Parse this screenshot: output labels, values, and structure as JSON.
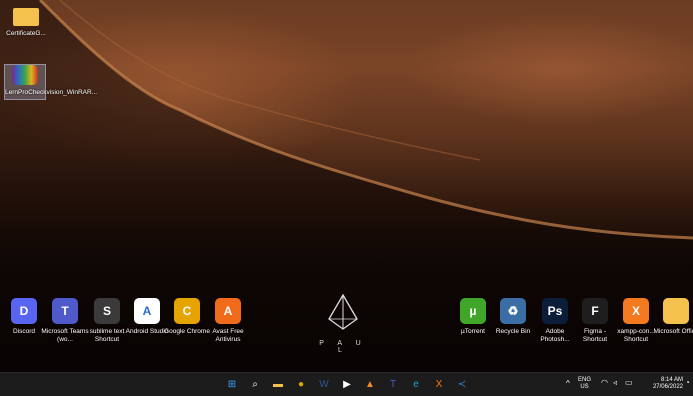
{
  "desktop_left": [
    {
      "label": "CertificateG...",
      "icon": "folder-icon"
    },
    {
      "label": "LernProCheckvision_WinRAR...",
      "icon": "winrar-icon"
    }
  ],
  "dock_left": [
    {
      "label": "Discord",
      "icon": "discord-icon",
      "color": "#5865F2",
      "glyph": "D"
    },
    {
      "label": "Microsoft Teams (wo...",
      "icon": "teams-icon",
      "color": "#5059C9",
      "glyph": "T"
    },
    {
      "label": "sublime text Shortcut",
      "icon": "sublime-icon",
      "color": "#3a3a3a",
      "glyph": "S"
    },
    {
      "label": "Android Studio",
      "icon": "android-studio-icon",
      "color": "#ffffff",
      "glyph": "A"
    },
    {
      "label": "Google Chrome",
      "icon": "chrome-icon",
      "color": "#e6a400",
      "glyph": "C"
    },
    {
      "label": "Avast Free Antivirus",
      "icon": "avast-icon",
      "color": "#f26b1d",
      "glyph": "A"
    }
  ],
  "dock_right": [
    {
      "label": "µTorrent",
      "icon": "utorrent-icon",
      "color": "#3fa62a",
      "glyph": "µ"
    },
    {
      "label": "Recycle Bin",
      "icon": "recycle-bin-icon",
      "color": "#3b6ea5",
      "glyph": "♻"
    },
    {
      "label": "Adobe Photosh...",
      "icon": "photoshop-icon",
      "color": "#0c1d3a",
      "glyph": "Ps"
    },
    {
      "label": "Figma - Shortcut",
      "icon": "figma-icon",
      "color": "#1e1e1e",
      "glyph": "F"
    },
    {
      "label": "xampp-con... Shortcut",
      "icon": "xampp-icon",
      "color": "#f47a20",
      "glyph": "X"
    },
    {
      "label": "Microsoft Office",
      "icon": "folder-icon",
      "color": "#f4c24c",
      "glyph": ""
    }
  ],
  "logo_text": "P A U L",
  "taskbar": {
    "icons": [
      {
        "name": "start-icon",
        "glyph": "⊞",
        "color": "#3aa0ff"
      },
      {
        "name": "search-icon",
        "glyph": "⌕",
        "color": "#ffffff"
      },
      {
        "name": "file-explorer-icon",
        "glyph": "▬",
        "color": "#f4c24c"
      },
      {
        "name": "chrome-icon",
        "glyph": "●",
        "color": "#e6a400"
      },
      {
        "name": "word-icon",
        "glyph": "W",
        "color": "#2b579a"
      },
      {
        "name": "media-player-icon",
        "glyph": "▶",
        "color": "#ffffff"
      },
      {
        "name": "vlc-icon",
        "glyph": "▲",
        "color": "#f48b1f"
      },
      {
        "name": "teams-icon",
        "glyph": "T",
        "color": "#5059C9"
      },
      {
        "name": "edge-icon",
        "glyph": "e",
        "color": "#1fa3d8"
      },
      {
        "name": "xampp-icon",
        "glyph": "X",
        "color": "#f47a20"
      },
      {
        "name": "vscode-icon",
        "glyph": "≺",
        "color": "#2a8ce8"
      }
    ],
    "lang_top": "ENG",
    "lang_bottom": "US",
    "time": "8:14 AM",
    "date": "27/06/2022"
  }
}
